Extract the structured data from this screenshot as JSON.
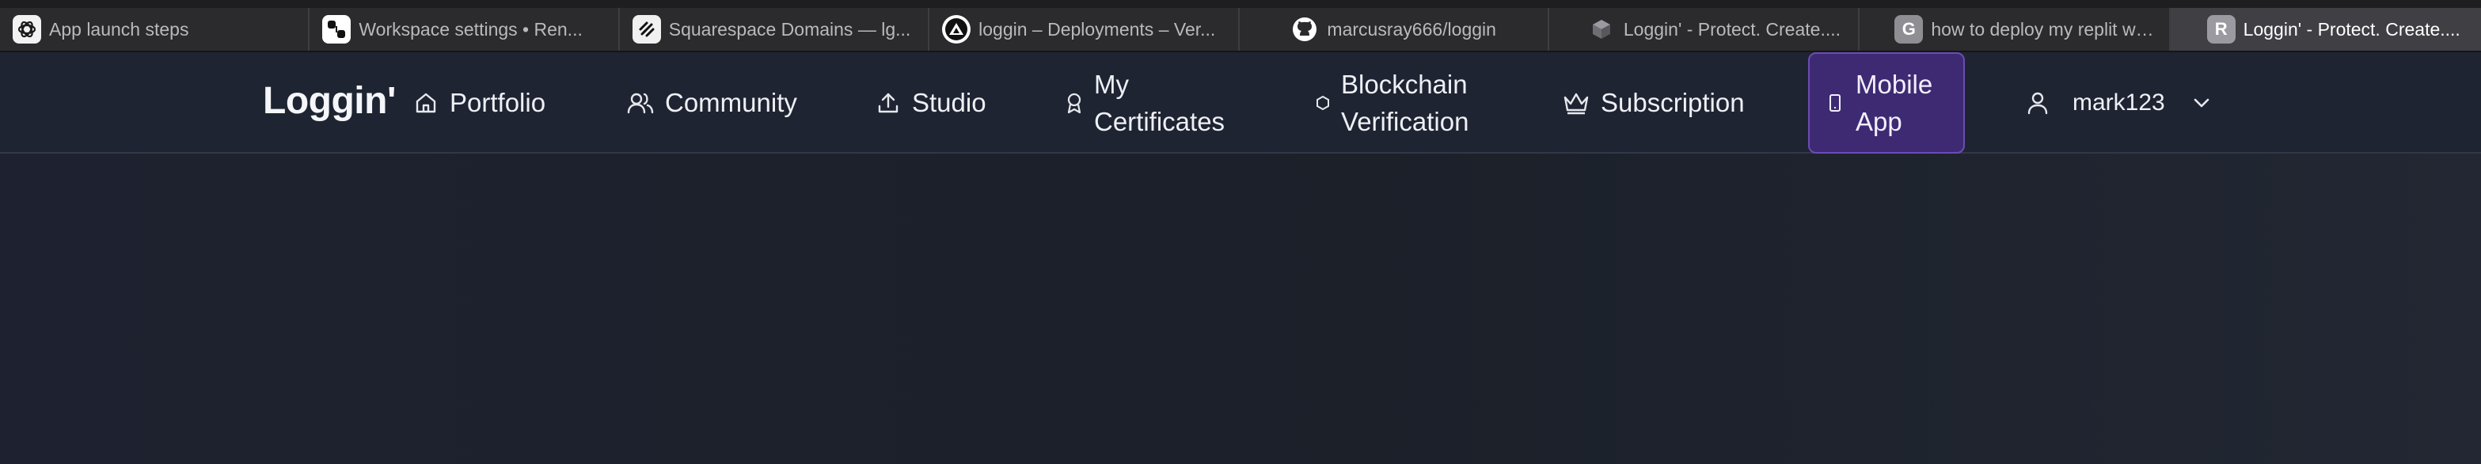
{
  "browser": {
    "tabs": [
      {
        "title": "App launch steps",
        "icon": "openai-icon",
        "active": false
      },
      {
        "title": "Workspace settings • Ren...",
        "icon": "render-icon",
        "active": false
      },
      {
        "title": "Squarespace Domains — lg...",
        "icon": "squarespace-icon",
        "active": false
      },
      {
        "title": "loggin – Deployments – Ver...",
        "icon": "vercel-icon",
        "active": false
      },
      {
        "title": "marcusray666/loggin",
        "icon": "github-icon",
        "active": false
      },
      {
        "title": "Loggin' - Protect. Create....",
        "icon": "cube-icon",
        "active": false
      },
      {
        "title": "how to deploy my replit we...",
        "icon": "g-letter-icon",
        "fav_letter": "G",
        "active": false
      },
      {
        "title": "Loggin' - Protect. Create....",
        "icon": "r-letter-icon",
        "fav_letter": "R",
        "active": true
      }
    ]
  },
  "app": {
    "brand": "Loggin'",
    "nav": {
      "portfolio": "Portfolio",
      "community": "Community",
      "studio": "Studio",
      "certificates": "My\nCertificates",
      "blockchain": "Blockchain\nVerification",
      "subscription": "Subscription",
      "mobile_app": "Mobile\nApp"
    },
    "user": {
      "name": "mark123"
    },
    "colors": {
      "accent": "#3e2a72",
      "accent_border": "#6c4bb8",
      "background": "#1c212d"
    }
  }
}
